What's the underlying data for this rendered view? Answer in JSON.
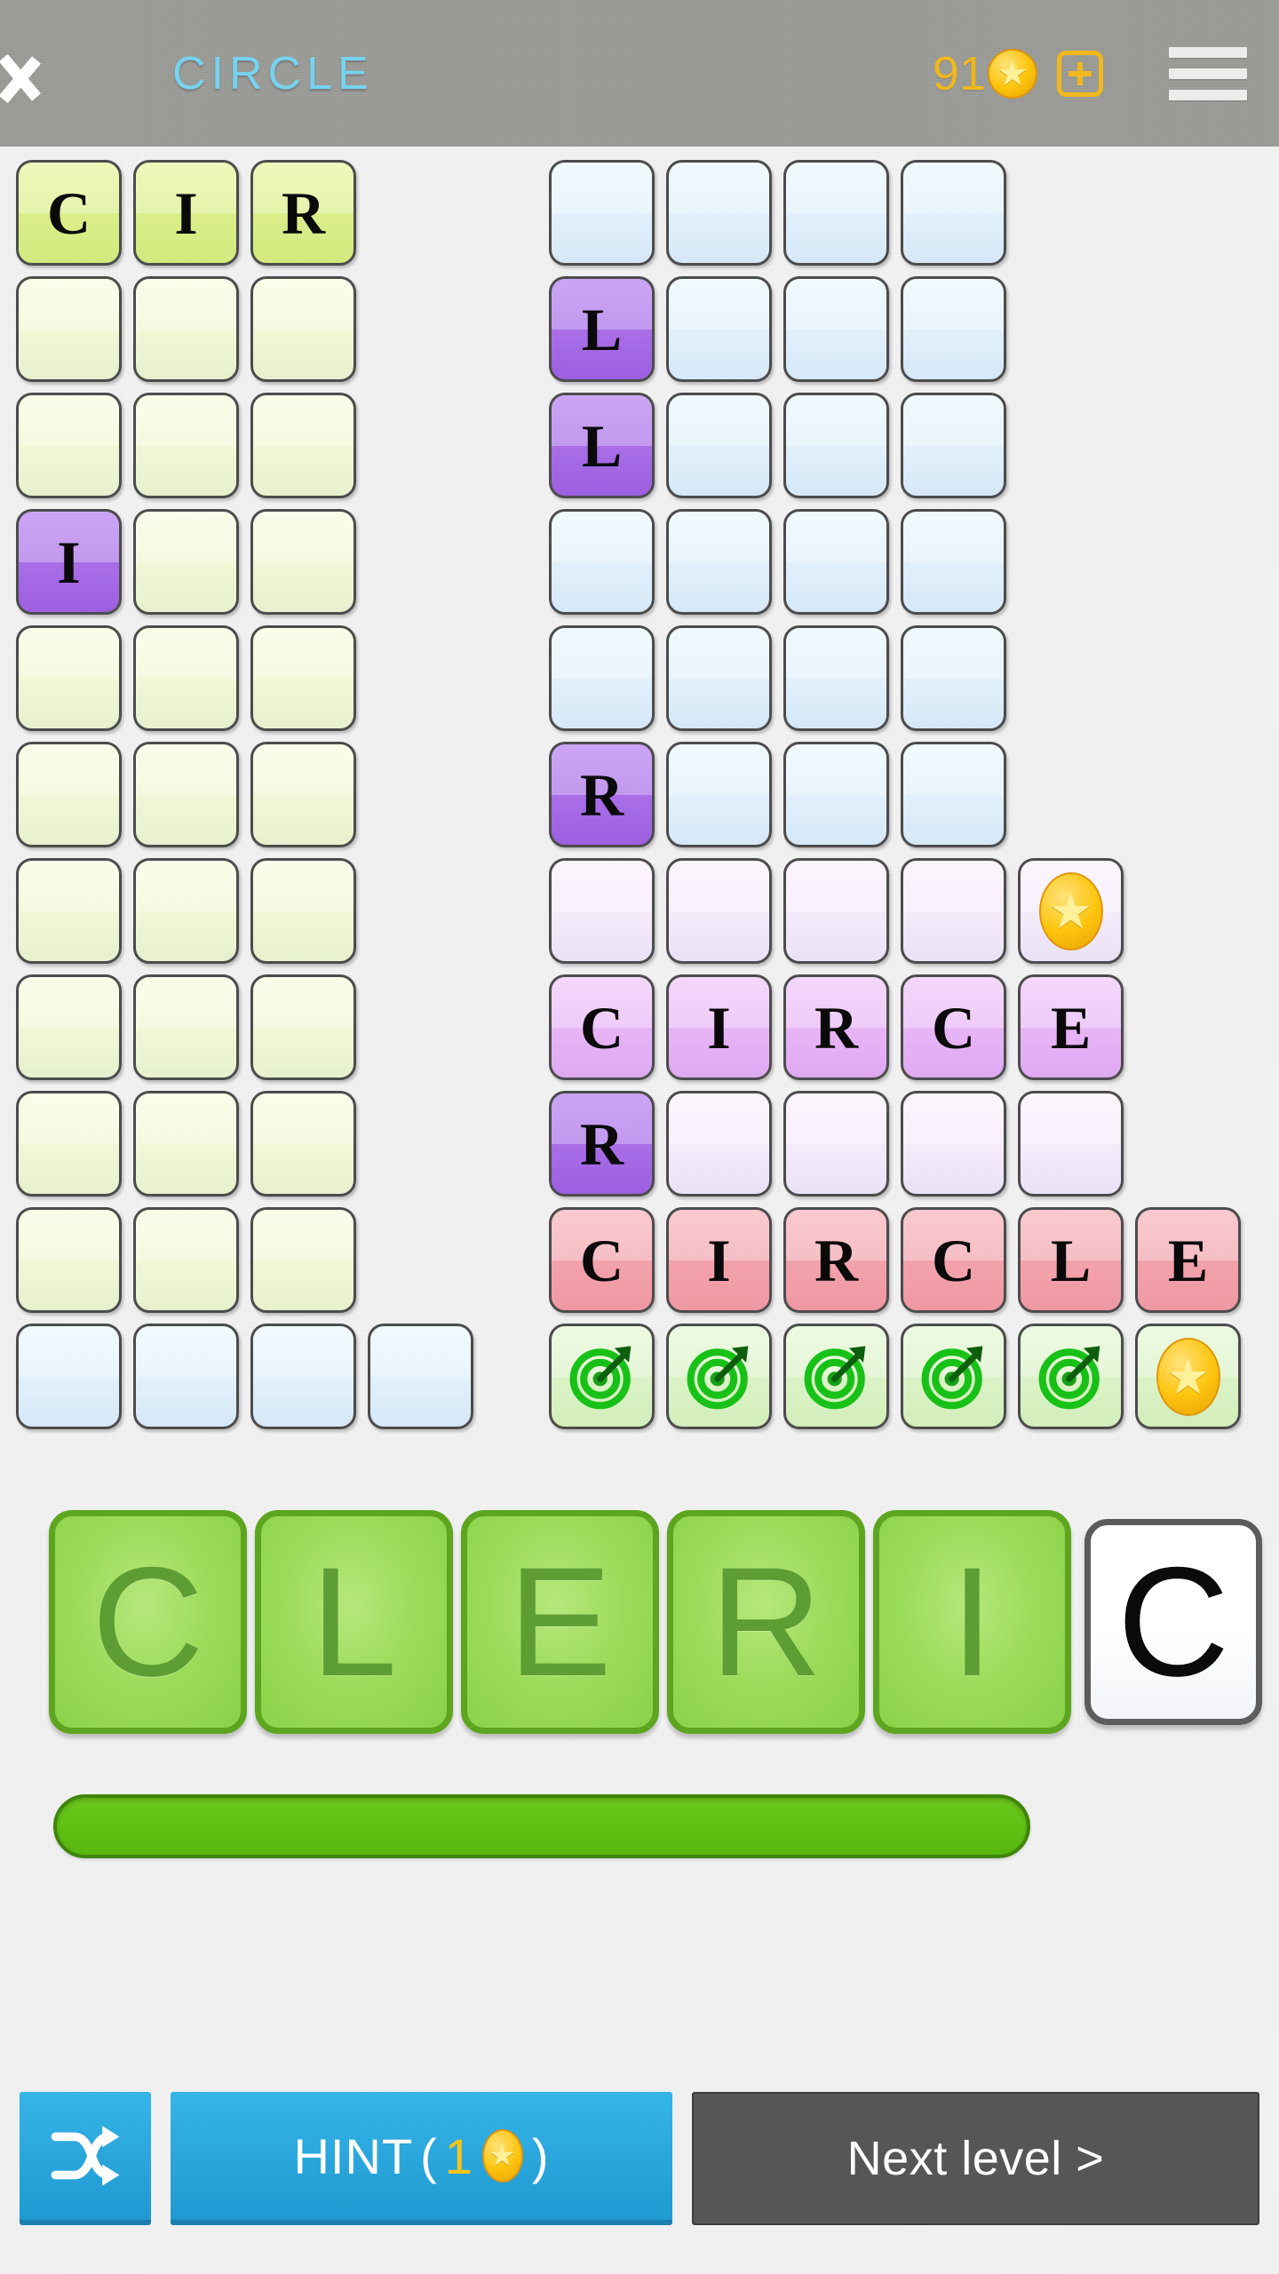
{
  "header": {
    "back_icon": "back-chevron-icon",
    "title": "CIRCLE",
    "coin_count": "91",
    "coin_icon": "star-coin-icon",
    "add_coins_icon": "plus-icon",
    "menu_icon": "hamburger-menu-icon",
    "bg_color": "#9a9a96",
    "title_color": "#77d2f0",
    "coin_color": "#f0b81e"
  },
  "board": {
    "left_grid": [
      {
        "cells": [
          {
            "letter": "C",
            "style": "green-filled"
          },
          {
            "letter": "I",
            "style": "green-filled"
          },
          {
            "letter": "R",
            "style": "green-filled"
          }
        ]
      },
      {
        "cells": [
          {
            "letter": "",
            "style": "green-empty"
          },
          {
            "letter": "",
            "style": "green-empty"
          },
          {
            "letter": "",
            "style": "green-empty"
          }
        ]
      },
      {
        "cells": [
          {
            "letter": "",
            "style": "green-empty"
          },
          {
            "letter": "",
            "style": "green-empty"
          },
          {
            "letter": "",
            "style": "green-empty"
          }
        ]
      },
      {
        "cells": [
          {
            "letter": "I",
            "style": "purple"
          },
          {
            "letter": "",
            "style": "green-empty"
          },
          {
            "letter": "",
            "style": "green-empty"
          }
        ]
      },
      {
        "cells": [
          {
            "letter": "",
            "style": "green-empty"
          },
          {
            "letter": "",
            "style": "green-empty"
          },
          {
            "letter": "",
            "style": "green-empty"
          }
        ]
      },
      {
        "cells": [
          {
            "letter": "",
            "style": "green-empty"
          },
          {
            "letter": "",
            "style": "green-empty"
          },
          {
            "letter": "",
            "style": "green-empty"
          }
        ]
      },
      {
        "cells": [
          {
            "letter": "",
            "style": "green-empty"
          },
          {
            "letter": "",
            "style": "green-empty"
          },
          {
            "letter": "",
            "style": "green-empty"
          }
        ]
      },
      {
        "cells": [
          {
            "letter": "",
            "style": "green-empty"
          },
          {
            "letter": "",
            "style": "green-empty"
          },
          {
            "letter": "",
            "style": "green-empty"
          }
        ]
      },
      {
        "cells": [
          {
            "letter": "",
            "style": "green-empty"
          },
          {
            "letter": "",
            "style": "green-empty"
          },
          {
            "letter": "",
            "style": "green-empty"
          }
        ]
      },
      {
        "cells": [
          {
            "letter": "",
            "style": "green-empty"
          },
          {
            "letter": "",
            "style": "green-empty"
          },
          {
            "letter": "",
            "style": "green-empty"
          }
        ]
      },
      {
        "cells": [
          {
            "letter": "",
            "style": "blue-empty"
          },
          {
            "letter": "",
            "style": "blue-empty"
          },
          {
            "letter": "",
            "style": "blue-empty"
          },
          {
            "letter": "",
            "style": "blue-empty"
          }
        ]
      }
    ],
    "right_grid": [
      {
        "cells": [
          {
            "letter": "",
            "style": "blue-empty"
          },
          {
            "letter": "",
            "style": "blue-empty"
          },
          {
            "letter": "",
            "style": "blue-empty"
          },
          {
            "letter": "",
            "style": "blue-empty"
          }
        ]
      },
      {
        "cells": [
          {
            "letter": "L",
            "style": "purple"
          },
          {
            "letter": "",
            "style": "blue-empty"
          },
          {
            "letter": "",
            "style": "blue-empty"
          },
          {
            "letter": "",
            "style": "blue-empty"
          }
        ]
      },
      {
        "cells": [
          {
            "letter": "L",
            "style": "purple"
          },
          {
            "letter": "",
            "style": "blue-empty"
          },
          {
            "letter": "",
            "style": "blue-empty"
          },
          {
            "letter": "",
            "style": "blue-empty"
          }
        ]
      },
      {
        "cells": [
          {
            "letter": "",
            "style": "blue-empty"
          },
          {
            "letter": "",
            "style": "blue-empty"
          },
          {
            "letter": "",
            "style": "blue-empty"
          },
          {
            "letter": "",
            "style": "blue-empty"
          }
        ]
      },
      {
        "cells": [
          {
            "letter": "",
            "style": "blue-empty"
          },
          {
            "letter": "",
            "style": "blue-empty"
          },
          {
            "letter": "",
            "style": "blue-empty"
          },
          {
            "letter": "",
            "style": "blue-empty"
          }
        ]
      },
      {
        "cells": [
          {
            "letter": "R",
            "style": "purple"
          },
          {
            "letter": "",
            "style": "blue-empty"
          },
          {
            "letter": "",
            "style": "blue-empty"
          },
          {
            "letter": "",
            "style": "blue-empty"
          }
        ]
      },
      {
        "cells": [
          {
            "letter": "",
            "style": "lav-empty"
          },
          {
            "letter": "",
            "style": "lav-empty"
          },
          {
            "letter": "",
            "style": "lav-empty"
          },
          {
            "letter": "",
            "style": "lav-empty"
          },
          {
            "icon": "star-coin-icon",
            "style": "lav-empty"
          }
        ]
      },
      {
        "cells": [
          {
            "letter": "C",
            "style": "lav-filled"
          },
          {
            "letter": "I",
            "style": "lav-filled"
          },
          {
            "letter": "R",
            "style": "lav-filled"
          },
          {
            "letter": "C",
            "style": "lav-filled"
          },
          {
            "letter": "E",
            "style": "lav-filled"
          }
        ]
      },
      {
        "cells": [
          {
            "letter": "R",
            "style": "purple"
          },
          {
            "letter": "",
            "style": "lav-empty"
          },
          {
            "letter": "",
            "style": "lav-empty"
          },
          {
            "letter": "",
            "style": "lav-empty"
          },
          {
            "letter": "",
            "style": "lav-empty"
          }
        ]
      },
      {
        "cells": [
          {
            "letter": "C",
            "style": "pink"
          },
          {
            "letter": "I",
            "style": "pink"
          },
          {
            "letter": "R",
            "style": "pink"
          },
          {
            "letter": "C",
            "style": "pink"
          },
          {
            "letter": "L",
            "style": "pink"
          },
          {
            "letter": "E",
            "style": "pink"
          }
        ]
      },
      {
        "cells": [
          {
            "icon": "target-icon",
            "style": "green-light"
          },
          {
            "icon": "target-icon",
            "style": "green-light"
          },
          {
            "icon": "target-icon",
            "style": "green-light"
          },
          {
            "icon": "target-icon",
            "style": "green-light"
          },
          {
            "icon": "target-icon",
            "style": "green-light"
          },
          {
            "icon": "star-coin-icon",
            "style": "green-light"
          }
        ]
      }
    ]
  },
  "answer": {
    "tiles": [
      {
        "letter": "C",
        "state": "placed"
      },
      {
        "letter": "L",
        "state": "placed"
      },
      {
        "letter": "E",
        "state": "placed"
      },
      {
        "letter": "R",
        "state": "placed"
      },
      {
        "letter": "I",
        "state": "placed"
      },
      {
        "letter": "C",
        "state": "available"
      }
    ],
    "progress_color": "#5fc013"
  },
  "bottom": {
    "shuffle_icon": "shuffle-icon",
    "hint_label": "HINT",
    "hint_open_paren": "(",
    "hint_cost": "1",
    "hint_coin_icon": "star-coin-icon",
    "hint_close_paren": ")",
    "next_label": "Next level >"
  }
}
